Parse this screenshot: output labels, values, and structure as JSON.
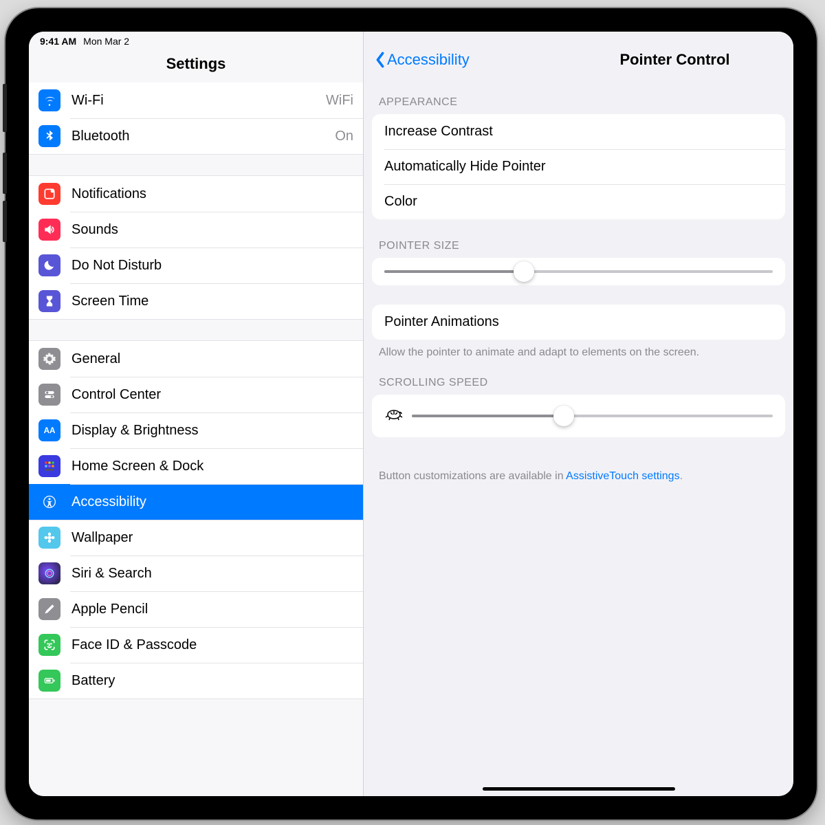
{
  "status": {
    "time": "9:41 AM",
    "date": "Mon Mar 2"
  },
  "sidebar": {
    "title": "Settings",
    "groups": [
      {
        "items": [
          {
            "id": "wifi",
            "label": "Wi-Fi",
            "value": "WiFi",
            "icon": "wifi-icon",
            "color": "#007aff"
          },
          {
            "id": "bluetooth",
            "label": "Bluetooth",
            "value": "On",
            "icon": "bluetooth-icon",
            "color": "#007aff"
          }
        ]
      },
      {
        "items": [
          {
            "id": "notifications",
            "label": "Notifications",
            "icon": "notifications-icon",
            "color": "#ff3b30"
          },
          {
            "id": "sounds",
            "label": "Sounds",
            "icon": "sounds-icon",
            "color": "#ff2d55"
          },
          {
            "id": "dnd",
            "label": "Do Not Disturb",
            "icon": "moon-icon",
            "color": "#5856d6"
          },
          {
            "id": "screentime",
            "label": "Screen Time",
            "icon": "hourglass-icon",
            "color": "#5856d6"
          }
        ]
      },
      {
        "items": [
          {
            "id": "general",
            "label": "General",
            "icon": "gear-icon",
            "color": "#8e8e93"
          },
          {
            "id": "controlcenter",
            "label": "Control Center",
            "icon": "switches-icon",
            "color": "#8e8e93"
          },
          {
            "id": "display",
            "label": "Display & Brightness",
            "icon": "aa-icon",
            "color": "#007aff"
          },
          {
            "id": "homescreen",
            "label": "Home Screen & Dock",
            "icon": "grid-icon",
            "color": "#3f51ff"
          },
          {
            "id": "accessibility",
            "label": "Accessibility",
            "icon": "accessibility-icon",
            "color": "#007aff",
            "selected": true
          },
          {
            "id": "wallpaper",
            "label": "Wallpaper",
            "icon": "flower-icon",
            "color": "#54c7ec"
          },
          {
            "id": "siri",
            "label": "Siri & Search",
            "icon": "siri-icon",
            "color": "#000000"
          },
          {
            "id": "applepencil",
            "label": "Apple Pencil",
            "icon": "pencil-icon",
            "color": "#8e8e93"
          },
          {
            "id": "faceid",
            "label": "Face ID & Passcode",
            "icon": "faceid-icon",
            "color": "#34c759"
          },
          {
            "id": "battery",
            "label": "Battery",
            "icon": "battery-icon",
            "color": "#34c759"
          }
        ]
      }
    ]
  },
  "detail": {
    "back_label": "Accessibility",
    "title": "Pointer Control",
    "sections": {
      "appearance": {
        "header": "APPEARANCE",
        "items": [
          {
            "label": "Increase Contrast"
          },
          {
            "label": "Automatically Hide Pointer"
          },
          {
            "label": "Color"
          }
        ]
      },
      "pointer_size": {
        "header": "POINTER SIZE",
        "slider_value": 36
      },
      "pointer_animations": {
        "item_label": "Pointer Animations",
        "footer": "Allow the pointer to animate and adapt to elements on the screen."
      },
      "scrolling_speed": {
        "header": "SCROLLING SPEED",
        "slider_value": 42,
        "left_icon": "turtle-icon"
      },
      "bottom_note": {
        "prefix": "Button customizations are available in ",
        "link": "AssistiveTouch settings",
        "suffix": "."
      }
    }
  }
}
